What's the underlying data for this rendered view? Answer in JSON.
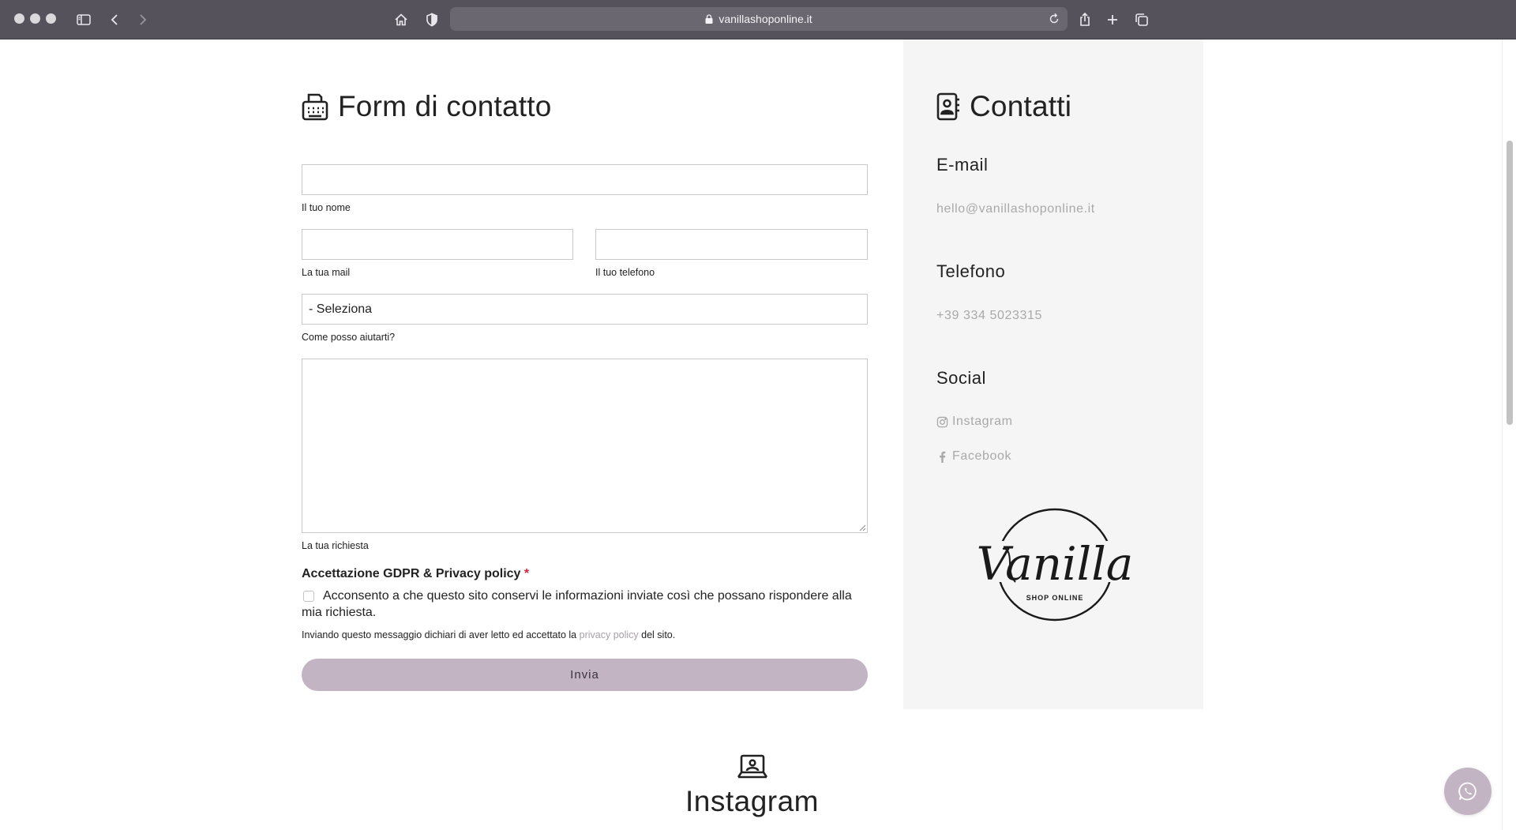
{
  "browser": {
    "url": "vanillashoponline.it"
  },
  "form": {
    "title": "Form di contatto",
    "fields": {
      "name_label": "Il tuo nome",
      "email_label": "La tua mail",
      "phone_label": "Il tuo telefono",
      "select_value": "- Seleziona",
      "select_label": "Come posso aiutarti?",
      "message_label": "La tua richiesta"
    },
    "gdpr": {
      "title": "Accettazione GDPR & Privacy policy",
      "required_mark": "*",
      "consent_text": "Acconsento a che questo sito conservi le informazioni inviate così che possano rispondere alla mia richiesta.",
      "notice_before": "Inviando questo messaggio dichiari di aver letto ed accettato la",
      "notice_link": "privacy policy",
      "notice_after": "del sito."
    },
    "submit_label": "Invia"
  },
  "contacts": {
    "title": "Contatti",
    "email_heading": "E-mail",
    "email_value": "hello@vanillashoponline.it",
    "phone_heading": "Telefono",
    "phone_value": "+39 334 5023315",
    "social_heading": "Social",
    "social_links": [
      "Instagram",
      "Facebook"
    ],
    "logo_text": "Vanilla",
    "logo_subtext": "SHOP ONLINE"
  },
  "instagram_section": {
    "title": "Instagram"
  },
  "colors": {
    "accent": "#c3b4c4",
    "sidebar_bg": "#f5f5f5",
    "muted_text": "#a9a9a9",
    "required": "#d0233d"
  }
}
